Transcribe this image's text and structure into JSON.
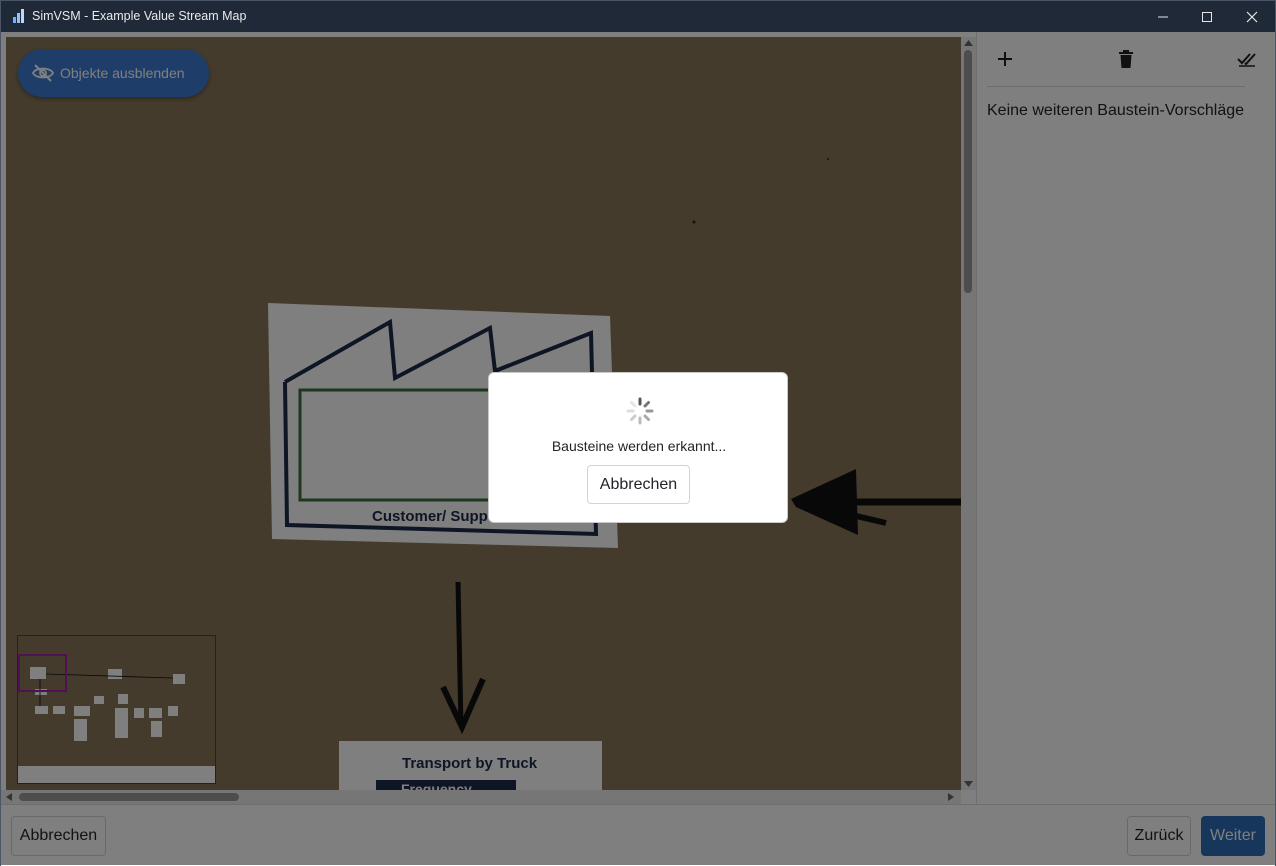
{
  "window": {
    "title": "SimVSM - Example Value Stream Map"
  },
  "canvas": {
    "hide_objects_label": "Objekte ausblenden",
    "photo_labels": {
      "supplier": "Customer/ Supp",
      "transport": "Transport by Truck",
      "frequency": "Frequency"
    }
  },
  "panel": {
    "tools": [
      {
        "name": "add-icon"
      },
      {
        "name": "trash-icon"
      },
      {
        "name": "check-all-icon"
      }
    ],
    "empty_message": "Keine weiteren Baustein-Vorschläge"
  },
  "footer": {
    "cancel_label": "Abbrechen",
    "back_label": "Zurück",
    "next_label": "Weiter"
  },
  "dialog": {
    "message": "Bausteine werden erkannt...",
    "cancel_label": "Abbrechen"
  },
  "colors": {
    "primary": "#2c6cb8",
    "titlebar": "#1f2937",
    "minimap_viewport": "#a020a8"
  }
}
